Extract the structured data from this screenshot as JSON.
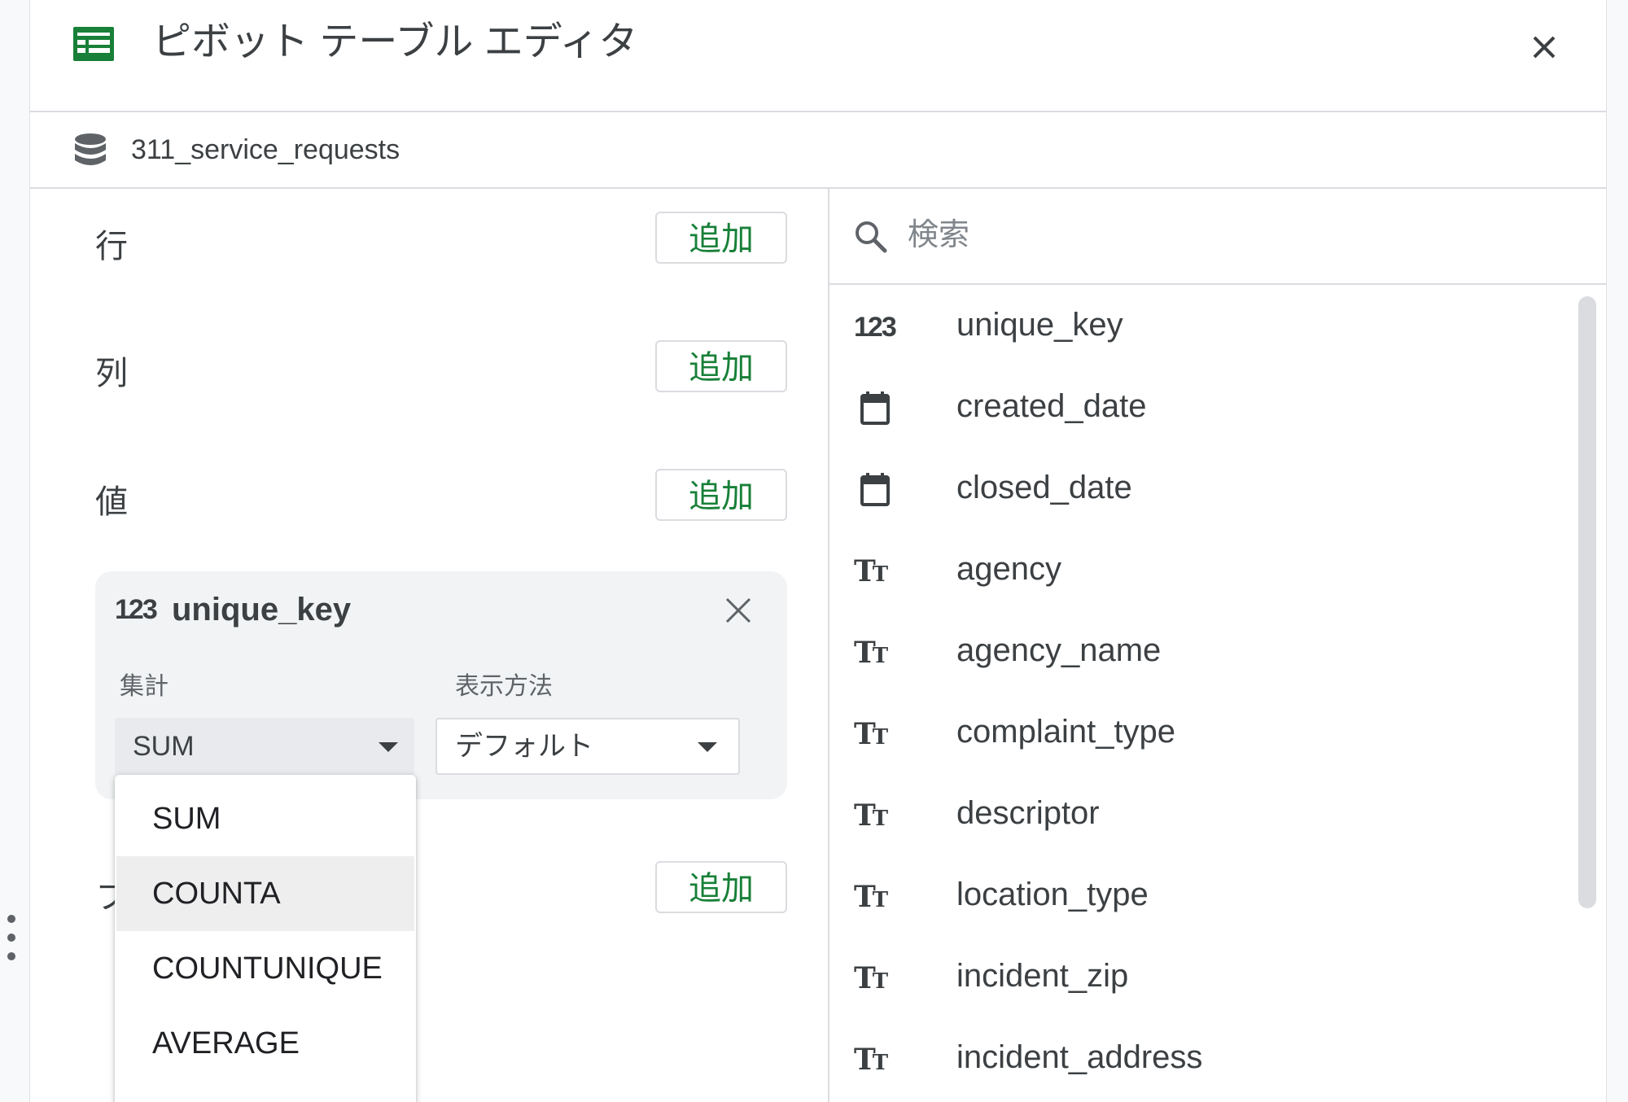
{
  "header": {
    "title": "ピボット テーブル エディタ",
    "icon": "table-icon",
    "close_icon": "close-icon",
    "accent_color": "#188038"
  },
  "source": {
    "name": "311_service_requests",
    "icon": "database-icon"
  },
  "sections": {
    "rows": {
      "label": "行",
      "add_label": "追加"
    },
    "columns": {
      "label": "列",
      "add_label": "追加"
    },
    "values": {
      "label": "値",
      "add_label": "追加"
    },
    "filters": {
      "label": "フ",
      "add_label": "追加"
    }
  },
  "value_card": {
    "type_icon": "123",
    "field": "unique_key",
    "aggregate_label": "集計",
    "aggregate_value": "SUM",
    "display_label": "表示方法",
    "display_value": "デフォルト"
  },
  "aggregate_menu": {
    "items": [
      "SUM",
      "COUNTA",
      "COUNTUNIQUE",
      "AVERAGE"
    ],
    "highlighted": "COUNTA"
  },
  "search": {
    "placeholder": "検索",
    "value": ""
  },
  "fields": [
    {
      "name": "unique_key",
      "type": "number",
      "icon_text": "123"
    },
    {
      "name": "created_date",
      "type": "date"
    },
    {
      "name": "closed_date",
      "type": "date"
    },
    {
      "name": "agency",
      "type": "text",
      "icon_big": "T",
      "icon_small": "T"
    },
    {
      "name": "agency_name",
      "type": "text",
      "icon_big": "T",
      "icon_small": "T"
    },
    {
      "name": "complaint_type",
      "type": "text",
      "icon_big": "T",
      "icon_small": "T"
    },
    {
      "name": "descriptor",
      "type": "text",
      "icon_big": "T",
      "icon_small": "T"
    },
    {
      "name": "location_type",
      "type": "text",
      "icon_big": "T",
      "icon_small": "T"
    },
    {
      "name": "incident_zip",
      "type": "text",
      "icon_big": "T",
      "icon_small": "T"
    },
    {
      "name": "incident_address",
      "type": "text",
      "icon_big": "T",
      "icon_small": "T"
    }
  ]
}
